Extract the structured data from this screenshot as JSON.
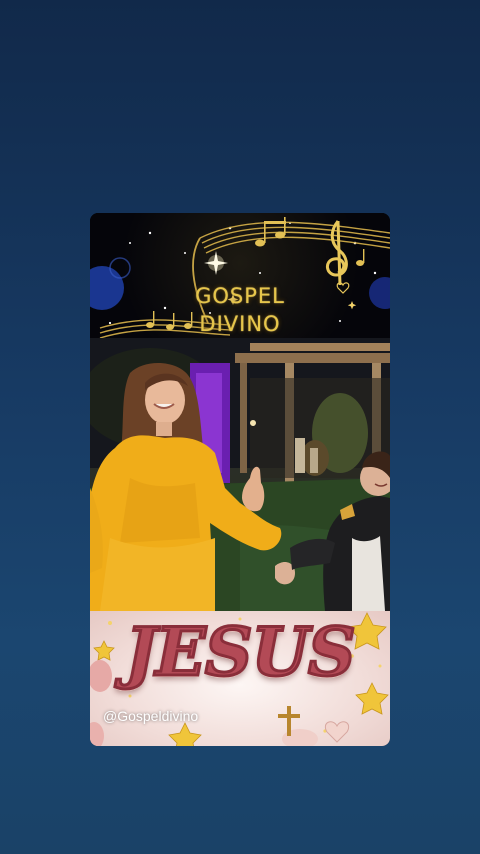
{
  "banner": {
    "title_line1": "GOSPEL",
    "title_line2": "DIVINO"
  },
  "jesus_panel": {
    "word": "JESUS",
    "handle": "@Gospeldivino"
  },
  "colors": {
    "background": "#173a63",
    "gold": "#e7c64a",
    "dress_yellow": "#f2b01d",
    "jesus_pink": "#b34a56"
  },
  "icons": [
    "music-notes-icon",
    "treble-clef-icon",
    "sparkle-icon",
    "star-icon",
    "cross-icon",
    "heart-icon"
  ]
}
